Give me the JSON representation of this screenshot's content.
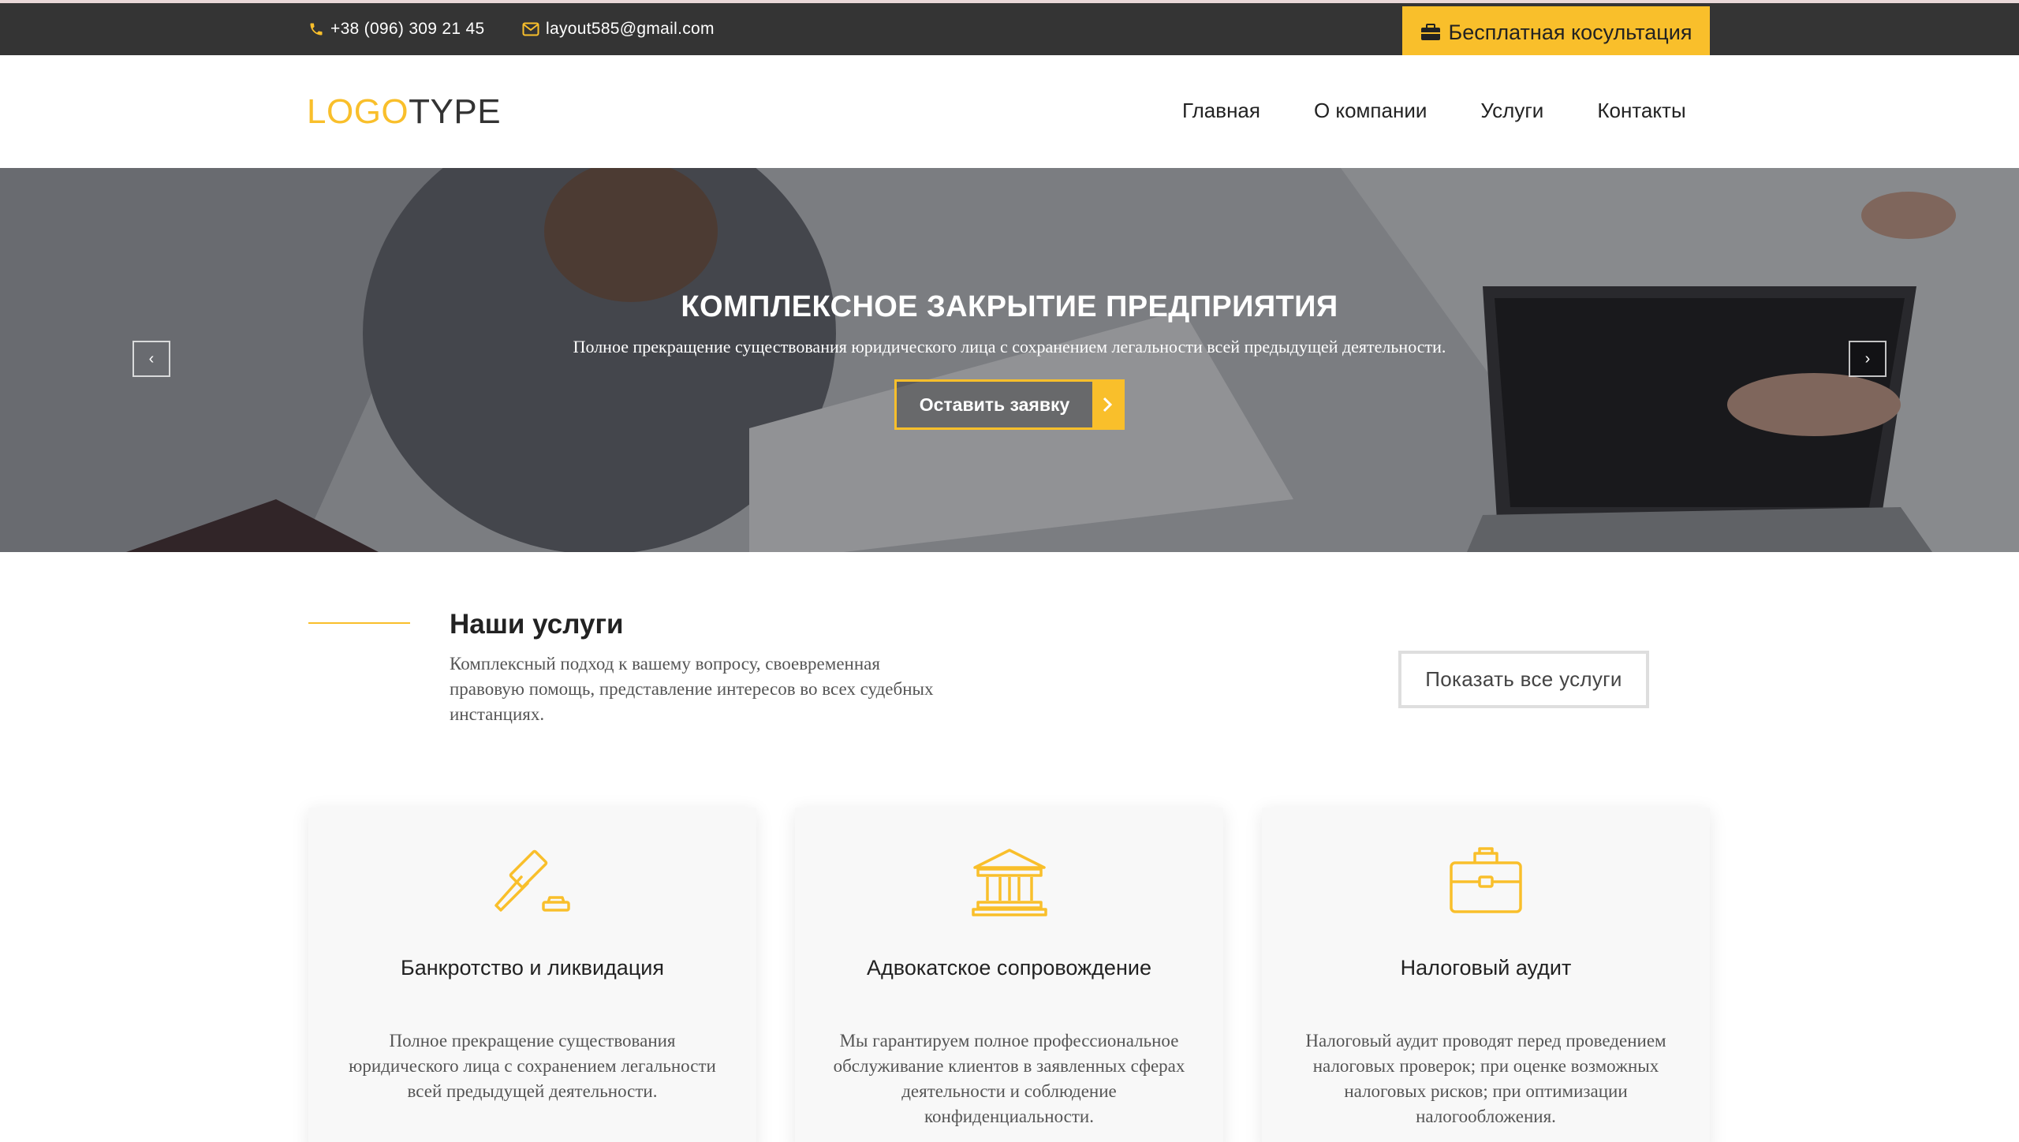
{
  "topbar": {
    "phone": "+38 (096) 309 21 45",
    "email": "layout585@gmail.com",
    "consult_label": "Бесплатная косультация"
  },
  "header": {
    "logo_part1": "LOGO",
    "logo_part2": "TYPE",
    "nav": [
      "Главная",
      "О компании",
      "Услуги",
      "Контакты"
    ]
  },
  "hero": {
    "title": "КОМПЛЕКСНОЕ ЗАКРЫТИЕ ПРЕДПРИЯТИЯ",
    "subtitle": "Полное прекращение существования юридического лица с сохранением легальности всей предыдущей деятельности.",
    "cta_label": "Оставить заявку"
  },
  "services": {
    "title": "Наши услуги",
    "description": "Комплексный подход к вашему вопросу, своевременная правовую помощь, представление интересов во всех судебных инстанциях.",
    "show_all_label": "Показать все услуги",
    "cards": [
      {
        "icon": "gavel-icon",
        "title": "Банкротство и ликвидация",
        "text": "Полное прекращение существования юридического лица с сохранением легальности всей предыдущей деятельности."
      },
      {
        "icon": "courthouse-icon",
        "title": "Адвокатское сопровождение",
        "text": "Мы гарантируем полное профессиональное обслуживание клиентов в заявленных сферах деятельности и соблюдение конфиденциальности."
      },
      {
        "icon": "briefcase-icon",
        "title": "Налоговый аудит",
        "text": "Налоговый аудит проводят перед проведением налоговых проверок; при оценке возможных налоговых рисков; при оптимизации налогообложения."
      }
    ]
  },
  "colors": {
    "accent": "#f9bf2b",
    "topbar_bg": "#343434"
  }
}
